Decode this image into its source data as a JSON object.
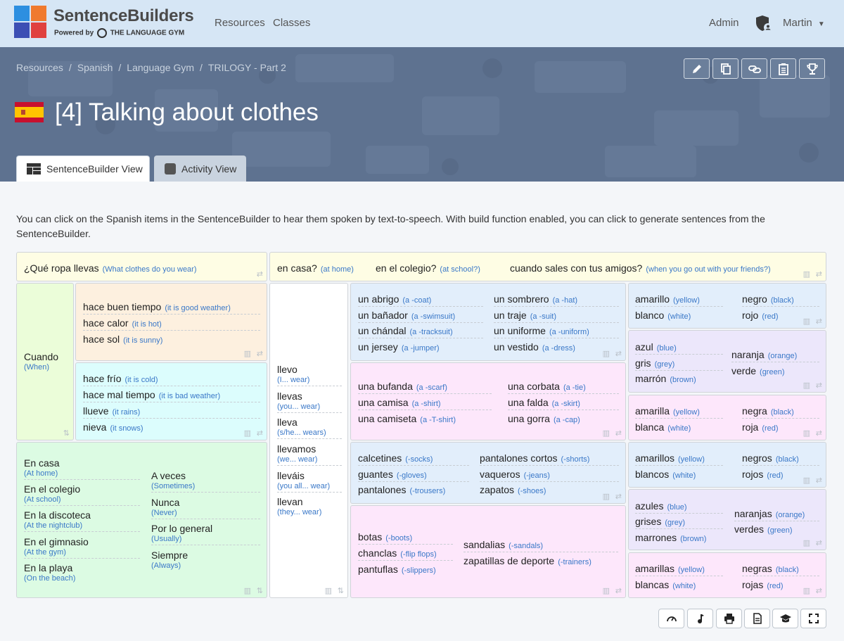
{
  "brand": {
    "name": "SentenceBuilders",
    "powered_by": "Powered by",
    "gym": "THE LANGUAGE GYM"
  },
  "nav": {
    "resources": "Resources",
    "classes": "Classes",
    "admin": "Admin",
    "user": "Martin"
  },
  "breadcrumb": [
    "Resources",
    "Spanish",
    "Language Gym",
    "TRILOGY - Part 2"
  ],
  "breadcrumb_sep": "/",
  "title": "[4] Talking about clothes",
  "tabs": {
    "builder": "SentenceBuilder View",
    "activity": "Activity View"
  },
  "intro": "You can click on the Spanish items in the SentenceBuilder to hear them spoken by text-to-speech. With build function enabled, you can click to generate sentences from the SentenceBuilder.",
  "q": {
    "es": "¿Qué ropa llevas",
    "en": "(What clothes do you wear)"
  },
  "places": [
    {
      "es": "en casa?",
      "en": "(at home)"
    },
    {
      "es": "en el colegio?",
      "en": "(at school?)"
    },
    {
      "es": "cuando sales con tus amigos?",
      "en": "(when you go out with your friends?)"
    }
  ],
  "cuando": {
    "es": "Cuando",
    "en": "(When)"
  },
  "weather_good": [
    {
      "es": "hace buen tiempo",
      "en": "(it is good weather)"
    },
    {
      "es": "hace calor",
      "en": "(it is hot)"
    },
    {
      "es": "hace sol",
      "en": "(it is sunny)"
    }
  ],
  "weather_bad": [
    {
      "es": "hace frío",
      "en": "(it is cold)"
    },
    {
      "es": "hace mal tiempo",
      "en": "(it is bad weather)"
    },
    {
      "es": "llueve",
      "en": "(it rains)"
    },
    {
      "es": "nieva",
      "en": "(it snows)"
    }
  ],
  "places2": [
    {
      "es": "En casa",
      "en": "(At home)"
    },
    {
      "es": "En el colegio",
      "en": "(At school)"
    },
    {
      "es": "En la discoteca",
      "en": "(At the nightclub)"
    },
    {
      "es": "En el gimnasio",
      "en": "(At the gym)"
    },
    {
      "es": "En la playa",
      "en": "(On the beach)"
    }
  ],
  "freq": [
    {
      "es": "A veces",
      "en": "(Sometimes)"
    },
    {
      "es": "Nunca",
      "en": "(Never)"
    },
    {
      "es": "Por lo general",
      "en": "(Usually)"
    },
    {
      "es": "Siempre",
      "en": "(Always)"
    }
  ],
  "verbs": [
    {
      "es": "llevo",
      "en": "(I... wear)"
    },
    {
      "es": "llevas",
      "en": "(you... wear)"
    },
    {
      "es": "lleva",
      "en": "(s/he... wears)"
    },
    {
      "es": "llevamos",
      "en": "(we... wear)"
    },
    {
      "es": "lleváis",
      "en": "(you all... wear)"
    },
    {
      "es": "llevan",
      "en": "(they... wear)"
    }
  ],
  "clothes_m": [
    {
      "es": "un abrigo",
      "en": "(a -coat)"
    },
    {
      "es": "un sombrero",
      "en": "(a -hat)"
    },
    {
      "es": "un bañador",
      "en": "(a -swimsuit)"
    },
    {
      "es": "un traje",
      "en": "(a -suit)"
    },
    {
      "es": "un chándal",
      "en": "(a -tracksuit)"
    },
    {
      "es": "un uniforme",
      "en": "(a -uniform)"
    },
    {
      "es": "un jersey",
      "en": "(a -jumper)"
    },
    {
      "es": "un vestido",
      "en": "(a -dress)"
    }
  ],
  "clothes_f": [
    {
      "es": "una bufanda",
      "en": "(a -scarf)"
    },
    {
      "es": "una corbata",
      "en": "(a -tie)"
    },
    {
      "es": "una camisa",
      "en": "(a -shirt)"
    },
    {
      "es": "una falda",
      "en": "(a -skirt)"
    },
    {
      "es": "una camiseta",
      "en": "(a -T-shirt)"
    },
    {
      "es": "una gorra",
      "en": "(a -cap)"
    }
  ],
  "clothes_mp": [
    {
      "es": "calcetines",
      "en": "(-socks)"
    },
    {
      "es": "pantalones cortos",
      "en": "(-shorts)"
    },
    {
      "es": "guantes",
      "en": "(-gloves)"
    },
    {
      "es": "vaqueros",
      "en": "(-jeans)"
    },
    {
      "es": "pantalones",
      "en": "(-trousers)"
    },
    {
      "es": "zapatos",
      "en": "(-shoes)"
    }
  ],
  "clothes_fp": [
    {
      "es": "botas",
      "en": "(-boots)"
    },
    {
      "es": "sandalias",
      "en": "(-sandals)"
    },
    {
      "es": "chanclas",
      "en": "(-flip flops)"
    },
    {
      "es": "zapatillas de deporte",
      "en": "(-trainers)"
    },
    {
      "es": "pantuflas",
      "en": "(-slippers)"
    }
  ],
  "adj_m1": [
    {
      "es": "amarillo",
      "en": "(yellow)"
    },
    {
      "es": "negro",
      "en": "(black)"
    },
    {
      "es": "blanco",
      "en": "(white)"
    },
    {
      "es": "rojo",
      "en": "(red)"
    }
  ],
  "adj_inv": [
    {
      "es": "azul",
      "en": "(blue)"
    },
    {
      "es": "naranja",
      "en": "(orange)"
    },
    {
      "es": "gris",
      "en": "(grey)"
    },
    {
      "es": "verde",
      "en": "(green)"
    },
    {
      "es": "marrón",
      "en": "(brown)"
    }
  ],
  "adj_f1": [
    {
      "es": "amarilla",
      "en": "(yellow)"
    },
    {
      "es": "negra",
      "en": "(black)"
    },
    {
      "es": "blanca",
      "en": "(white)"
    },
    {
      "es": "roja",
      "en": "(red)"
    }
  ],
  "adj_mp": [
    {
      "es": "amarillos",
      "en": "(yellow)"
    },
    {
      "es": "negros",
      "en": "(black)"
    },
    {
      "es": "blancos",
      "en": "(white)"
    },
    {
      "es": "rojos",
      "en": "(red)"
    }
  ],
  "adj_invp": [
    {
      "es": "azules",
      "en": "(blue)"
    },
    {
      "es": "naranjas",
      "en": "(orange)"
    },
    {
      "es": "grises",
      "en": "(grey)"
    },
    {
      "es": "verdes",
      "en": "(green)"
    },
    {
      "es": "marrones",
      "en": "(brown)"
    }
  ],
  "adj_fp": [
    {
      "es": "amarillas",
      "en": "(yellow)"
    },
    {
      "es": "negras",
      "en": "(black)"
    },
    {
      "es": "blancas",
      "en": "(white)"
    },
    {
      "es": "rojas",
      "en": "(red)"
    }
  ],
  "colors": {
    "yellow": "#fefde4",
    "peach": "#fdf0df",
    "mint": "#dcfdfd",
    "lime": "#ebfdd9",
    "green": "#dcfbe3",
    "blue": "#e2eefb",
    "pink": "#fde7fb",
    "lavender": "#ece7fb",
    "link": "#3a78c8"
  }
}
